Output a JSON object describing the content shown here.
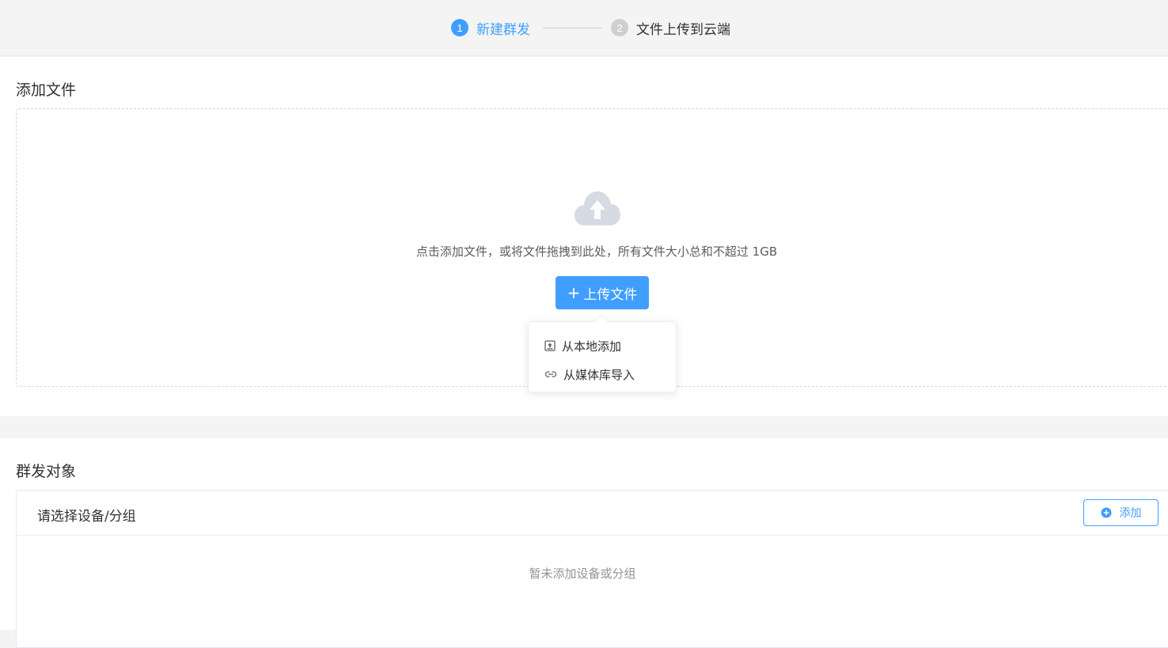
{
  "steps": [
    {
      "number": "1",
      "label": "新建群发",
      "state": "active"
    },
    {
      "number": "2",
      "label": "文件上传到云端",
      "state": "pending"
    }
  ],
  "files_section": {
    "title": "添加文件",
    "hint": "点击添加文件，或将文件拖拽到此处，所有文件大小总和不超过 1GB",
    "upload_button": {
      "plus": "+",
      "label": "上传文件"
    },
    "menu": [
      {
        "icon": "upload-box-icon",
        "label": "从本地添加"
      },
      {
        "icon": "link-icon",
        "label": "从媒体库导入"
      }
    ]
  },
  "targets_section": {
    "title": "群发对象",
    "panel_label": "请选择设备/分组",
    "add_button": {
      "icon": "plus-circle-icon",
      "label": "添加"
    },
    "empty_text": "暂未添加设备或分组"
  },
  "colors": {
    "accent": "#409eff",
    "inactive_step": "#cfcfcf",
    "muted_text": "#909399",
    "cloud_icon": "#d5dae3"
  }
}
